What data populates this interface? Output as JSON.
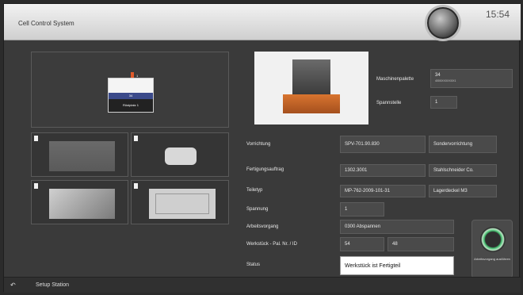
{
  "header": {
    "title": "Cell Control System",
    "clock": "15:54"
  },
  "overview": {
    "tile_label": "Rüstplatz 1",
    "tile_value": "34",
    "marker_number": "1"
  },
  "machine": {
    "palette_label": "Maschinenpalette",
    "palette_value": "34",
    "palette_sub": "400XXXXXXXX1",
    "clamp_label": "Spannstelle",
    "clamp_value": "1"
  },
  "form": {
    "vorrichtung_label": "Vorrichtung",
    "vorrichtung_value": "SPV-701.90.830",
    "vorrichtung_type": "Sondervorrichtung",
    "auftrag_label": "Fertigungsauftrag",
    "auftrag_value": "1302.3001",
    "auftrag_customer": "Stahlschneider Co.",
    "teiletyp_label": "Teiletyp",
    "teiletyp_value": "MP-762-2009-101-31",
    "teiletyp_name": "Lagerdeckel M3",
    "spannung_label": "Spannung",
    "spannung_value": "1",
    "arbeitsvorgang_label": "Arbeitsvorgang",
    "arbeitsvorgang_value": "0300 Abspannen",
    "werkstueck_label": "Werkstück - Pal. Nr. / ID",
    "werkstueck_pal": "54",
    "werkstueck_id": "48",
    "status_label": "Status",
    "status_value": "Werkstück ist Fertigteil"
  },
  "exec_button": {
    "label": "Arbeitsvorgang ausführen"
  },
  "footer": {
    "setup_label": "Setup Station"
  },
  "colors": {
    "accent_green": "#3fb86a",
    "tile_blue": "#3b4a8a",
    "marker_orange": "#e05a2a"
  }
}
